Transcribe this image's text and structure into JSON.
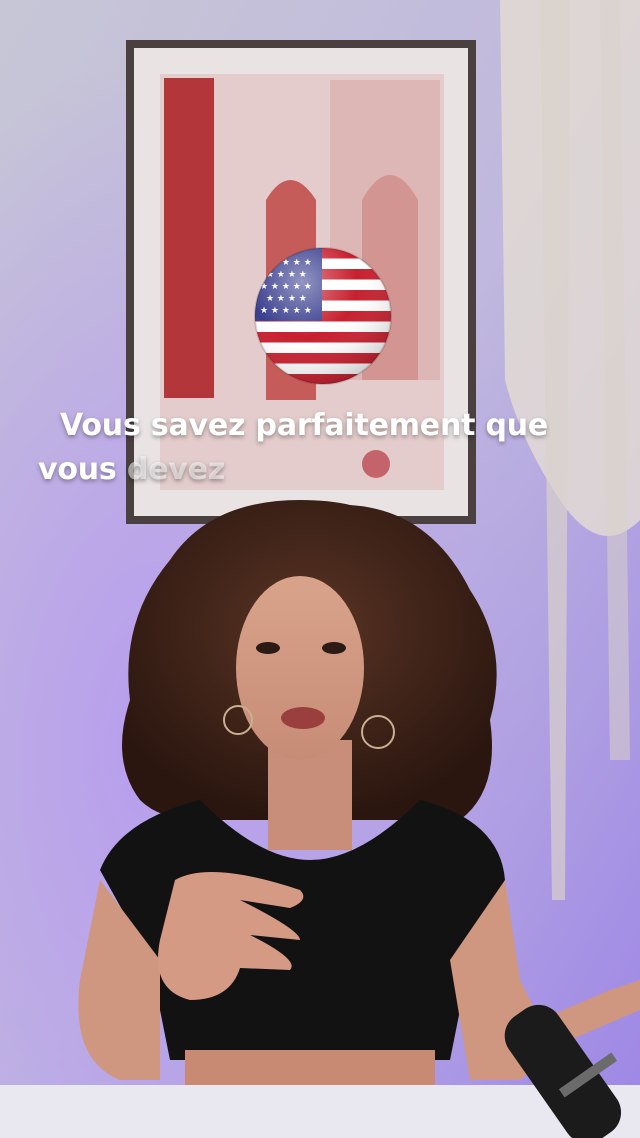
{
  "caption": {
    "line1": "Vous savez parfaitement que",
    "line2_spoken": "vous",
    "line2_upcoming": "devez"
  },
  "icons": {
    "flag": "us-flag-icon"
  },
  "colors": {
    "flag_red": "#c8202f",
    "flag_blue": "#3a3f8f",
    "caption_text": "#ffffff"
  }
}
